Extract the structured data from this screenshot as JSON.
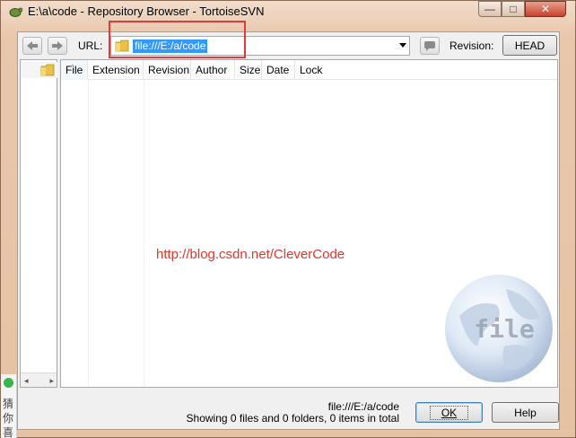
{
  "window": {
    "title": "E:\\a\\code - Repository Browser - TortoiseSVN",
    "minimize_glyph": "—",
    "maximize_glyph": "□",
    "close_glyph": "✕"
  },
  "toolbar": {
    "url_label": "URL:",
    "url_value": "file:///E:/a/code",
    "revision_label": "Revision:",
    "revision_button": "HEAD"
  },
  "list": {
    "columns": [
      "File",
      "Extension",
      "Revision",
      "Author",
      "Size",
      "Date",
      "Lock"
    ],
    "sort_arrow": "^"
  },
  "overlay": {
    "watermark_url": "http://blog.csdn.net/CleverCode",
    "globe_text": "file"
  },
  "status": {
    "url": "file:///E:/a/code",
    "summary": "Showing 0 files and 0 folders, 0 items in total"
  },
  "buttons": {
    "ok": "OK",
    "help": "Help"
  },
  "tree": {
    "scroll_left": "◂",
    "scroll_right": "▸"
  },
  "side_strip": {
    "chars": [
      "猜",
      "你",
      "喜"
    ]
  },
  "colors": {
    "selection": "#3399ff",
    "highlight_box": "#e2393a",
    "watermark": "#e4362e"
  }
}
